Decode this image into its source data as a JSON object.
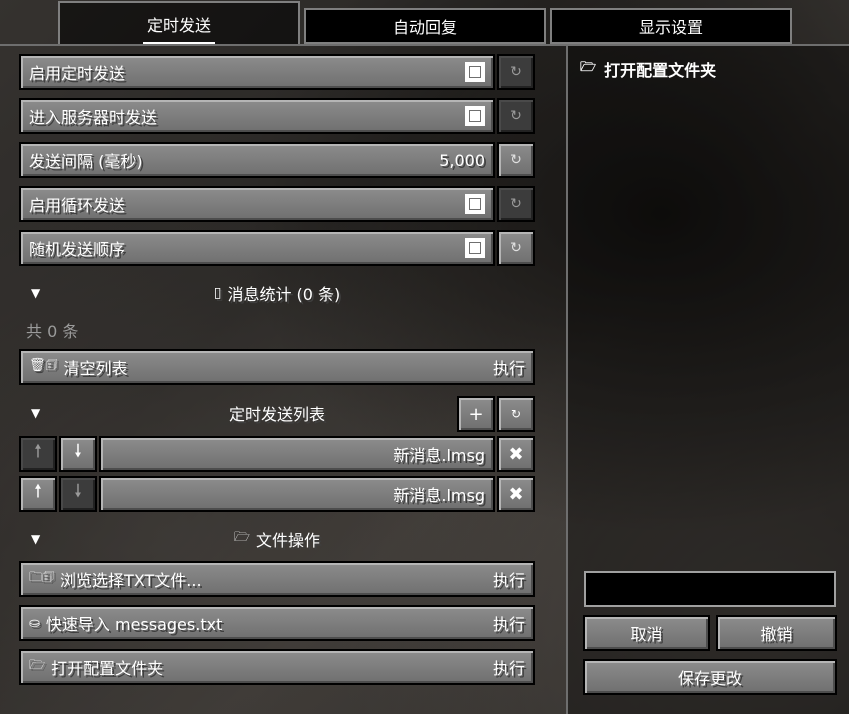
{
  "tabs": [
    {
      "label": "定时发送",
      "active": true
    },
    {
      "label": "自动回复",
      "active": false
    },
    {
      "label": "显示设置",
      "active": false
    }
  ],
  "settings": [
    {
      "label": "启用定时发送",
      "type": "checkbox",
      "checked": true,
      "reset_enabled": false
    },
    {
      "label": "进入服务器时发送",
      "type": "checkbox",
      "checked": true,
      "reset_enabled": false
    },
    {
      "label": "发送间隔 (毫秒)",
      "type": "number",
      "value": "5,000",
      "reset_enabled": true
    },
    {
      "label": "启用循环发送",
      "type": "checkbox",
      "checked": true,
      "reset_enabled": false
    },
    {
      "label": "随机发送顺序",
      "type": "checkbox",
      "checked": true,
      "reset_enabled": true
    }
  ],
  "stats_section": {
    "title": "消息统计 (0 条)",
    "count_text": "共 0 条"
  },
  "clear_list": {
    "icon": "🗑🗊",
    "label": "清空列表",
    "action": "执行"
  },
  "send_list_section": {
    "title": "定时发送列表",
    "add": "+",
    "reset": "↻"
  },
  "messages": [
    {
      "text": "新消息.lmsg",
      "up_enabled": false,
      "down_enabled": true
    },
    {
      "text": "新消息.lmsg",
      "up_enabled": true,
      "down_enabled": false
    }
  ],
  "file_section": {
    "title": "文件操作"
  },
  "file_actions": [
    {
      "icon": "🗀🗊",
      "label": "浏览选择TXT文件...",
      "action": "执行"
    },
    {
      "icon": "⛀",
      "label": "快速导入 messages.txt",
      "action": "执行"
    },
    {
      "icon": "🗁",
      "label": "打开配置文件夹",
      "action": "执行"
    }
  ],
  "right_panel": {
    "open_folder_link": "打开配置文件夹",
    "cancel": "取消",
    "undo": "撤销",
    "save": "保存更改"
  },
  "glyphs": {
    "reset": "↻",
    "up": "🠕",
    "down": "🠗",
    "remove": "✖",
    "section_arrow": "▼",
    "clipboard": "▯",
    "folder": "🗁"
  }
}
